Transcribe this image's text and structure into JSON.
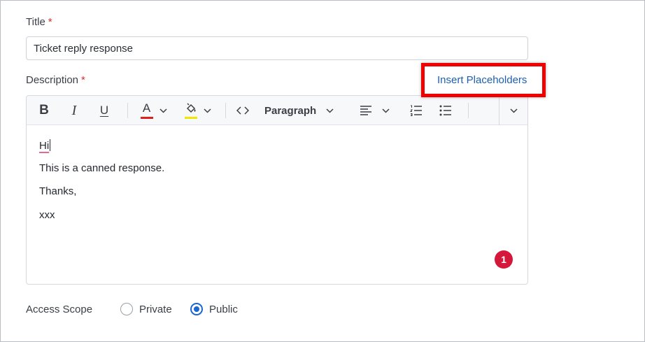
{
  "title_field": {
    "label": "Title",
    "required_mark": "*",
    "value": "Ticket reply response"
  },
  "description_field": {
    "label": "Description",
    "required_mark": "*",
    "insert_link": "Insert Placeholders"
  },
  "toolbar": {
    "bold": "B",
    "italic": "I",
    "underline": "U",
    "font_color": "A",
    "block_format": "Paragraph",
    "font_color_swatch": "#e02020",
    "highlight_swatch": "#f2e600",
    "icons": [
      "bold-icon",
      "italic-icon",
      "underline-icon",
      "font-color-icon",
      "highlight-icon",
      "code-icon",
      "align-left-icon",
      "numbered-list-icon",
      "bulleted-list-icon",
      "chevron-down-icon"
    ]
  },
  "editor_content": {
    "greeting": "Hi",
    "lines": [
      "This is a canned response.",
      "Thanks,",
      "xxx"
    ]
  },
  "step_badge": "1",
  "access_scope": {
    "label": "Access Scope",
    "options": [
      {
        "label": "Private",
        "selected": false
      },
      {
        "label": "Public",
        "selected": true
      }
    ]
  },
  "colors": {
    "accent": "#1a66d2",
    "highlight_box": "#ee0000",
    "required": "#d72b2b",
    "badge": "#d6173c",
    "link": "#1a5fb4"
  }
}
